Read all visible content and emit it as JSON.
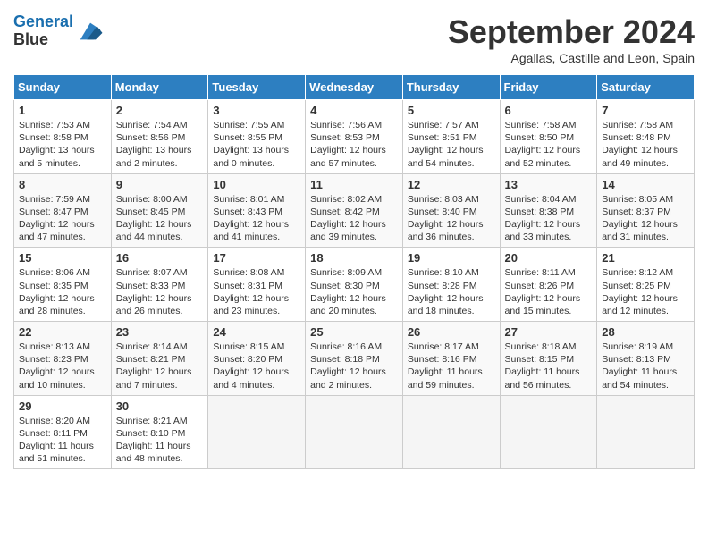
{
  "header": {
    "logo_line1": "General",
    "logo_line2": "Blue",
    "month_title": "September 2024",
    "location": "Agallas, Castille and Leon, Spain"
  },
  "days_of_week": [
    "Sunday",
    "Monday",
    "Tuesday",
    "Wednesday",
    "Thursday",
    "Friday",
    "Saturday"
  ],
  "weeks": [
    [
      {
        "day": 1,
        "sunrise": "7:53 AM",
        "sunset": "8:58 PM",
        "daylight": "13 hours and 5 minutes."
      },
      {
        "day": 2,
        "sunrise": "7:54 AM",
        "sunset": "8:56 PM",
        "daylight": "13 hours and 2 minutes."
      },
      {
        "day": 3,
        "sunrise": "7:55 AM",
        "sunset": "8:55 PM",
        "daylight": "13 hours and 0 minutes."
      },
      {
        "day": 4,
        "sunrise": "7:56 AM",
        "sunset": "8:53 PM",
        "daylight": "12 hours and 57 minutes."
      },
      {
        "day": 5,
        "sunrise": "7:57 AM",
        "sunset": "8:51 PM",
        "daylight": "12 hours and 54 minutes."
      },
      {
        "day": 6,
        "sunrise": "7:58 AM",
        "sunset": "8:50 PM",
        "daylight": "12 hours and 52 minutes."
      },
      {
        "day": 7,
        "sunrise": "7:58 AM",
        "sunset": "8:48 PM",
        "daylight": "12 hours and 49 minutes."
      }
    ],
    [
      {
        "day": 8,
        "sunrise": "7:59 AM",
        "sunset": "8:47 PM",
        "daylight": "12 hours and 47 minutes."
      },
      {
        "day": 9,
        "sunrise": "8:00 AM",
        "sunset": "8:45 PM",
        "daylight": "12 hours and 44 minutes."
      },
      {
        "day": 10,
        "sunrise": "8:01 AM",
        "sunset": "8:43 PM",
        "daylight": "12 hours and 41 minutes."
      },
      {
        "day": 11,
        "sunrise": "8:02 AM",
        "sunset": "8:42 PM",
        "daylight": "12 hours and 39 minutes."
      },
      {
        "day": 12,
        "sunrise": "8:03 AM",
        "sunset": "8:40 PM",
        "daylight": "12 hours and 36 minutes."
      },
      {
        "day": 13,
        "sunrise": "8:04 AM",
        "sunset": "8:38 PM",
        "daylight": "12 hours and 33 minutes."
      },
      {
        "day": 14,
        "sunrise": "8:05 AM",
        "sunset": "8:37 PM",
        "daylight": "12 hours and 31 minutes."
      }
    ],
    [
      {
        "day": 15,
        "sunrise": "8:06 AM",
        "sunset": "8:35 PM",
        "daylight": "12 hours and 28 minutes."
      },
      {
        "day": 16,
        "sunrise": "8:07 AM",
        "sunset": "8:33 PM",
        "daylight": "12 hours and 26 minutes."
      },
      {
        "day": 17,
        "sunrise": "8:08 AM",
        "sunset": "8:31 PM",
        "daylight": "12 hours and 23 minutes."
      },
      {
        "day": 18,
        "sunrise": "8:09 AM",
        "sunset": "8:30 PM",
        "daylight": "12 hours and 20 minutes."
      },
      {
        "day": 19,
        "sunrise": "8:10 AM",
        "sunset": "8:28 PM",
        "daylight": "12 hours and 18 minutes."
      },
      {
        "day": 20,
        "sunrise": "8:11 AM",
        "sunset": "8:26 PM",
        "daylight": "12 hours and 15 minutes."
      },
      {
        "day": 21,
        "sunrise": "8:12 AM",
        "sunset": "8:25 PM",
        "daylight": "12 hours and 12 minutes."
      }
    ],
    [
      {
        "day": 22,
        "sunrise": "8:13 AM",
        "sunset": "8:23 PM",
        "daylight": "12 hours and 10 minutes."
      },
      {
        "day": 23,
        "sunrise": "8:14 AM",
        "sunset": "8:21 PM",
        "daylight": "12 hours and 7 minutes."
      },
      {
        "day": 24,
        "sunrise": "8:15 AM",
        "sunset": "8:20 PM",
        "daylight": "12 hours and 4 minutes."
      },
      {
        "day": 25,
        "sunrise": "8:16 AM",
        "sunset": "8:18 PM",
        "daylight": "12 hours and 2 minutes."
      },
      {
        "day": 26,
        "sunrise": "8:17 AM",
        "sunset": "8:16 PM",
        "daylight": "11 hours and 59 minutes."
      },
      {
        "day": 27,
        "sunrise": "8:18 AM",
        "sunset": "8:15 PM",
        "daylight": "11 hours and 56 minutes."
      },
      {
        "day": 28,
        "sunrise": "8:19 AM",
        "sunset": "8:13 PM",
        "daylight": "11 hours and 54 minutes."
      }
    ],
    [
      {
        "day": 29,
        "sunrise": "8:20 AM",
        "sunset": "8:11 PM",
        "daylight": "11 hours and 51 minutes."
      },
      {
        "day": 30,
        "sunrise": "8:21 AM",
        "sunset": "8:10 PM",
        "daylight": "11 hours and 48 minutes."
      },
      null,
      null,
      null,
      null,
      null
    ]
  ]
}
